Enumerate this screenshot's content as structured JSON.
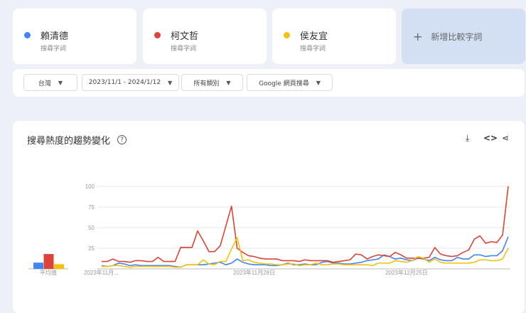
{
  "terms": [
    {
      "name": "賴清德",
      "sub": "搜尋字詞",
      "color": "#4285f4"
    },
    {
      "name": "柯文哲",
      "sub": "搜尋字詞",
      "color": "#db4437"
    },
    {
      "name": "侯友宜",
      "sub": "搜尋字詞",
      "color": "#f4c20d"
    }
  ],
  "add_term": {
    "label": "新增比較字詞",
    "icon": "plus-icon"
  },
  "filters": {
    "region": "台灣",
    "date_range": "2023/11/1 - 2024/1/12",
    "category": "所有類別",
    "search_type": "Google 網頁搜尋"
  },
  "chart_section": {
    "title": "搜尋熱度的趨勢變化",
    "help": "?",
    "icons": [
      "download-icon",
      "embed-icon",
      "share-icon"
    ]
  },
  "chart_data": {
    "type": "line",
    "title": "搜尋熱度的趨勢變化",
    "ylim": [
      0,
      100
    ],
    "yticks": [
      "100",
      "75",
      "50",
      "25"
    ],
    "xtick_labels": [
      "2023年11月...",
      "2023年11月28日",
      "2023年12月25日"
    ],
    "x_start": "2023-11-01",
    "x_end": "2024-01-12",
    "average_label": "平均值",
    "averages": [
      8,
      19,
      6
    ],
    "series": [
      {
        "name": "賴清德",
        "color": "#4285f4",
        "values": [
          4,
          3,
          4,
          7,
          6,
          4,
          5,
          4,
          4,
          4,
          4,
          4,
          4,
          3,
          2,
          5,
          5,
          5,
          5,
          6,
          7,
          8,
          5,
          7,
          12,
          8,
          6,
          5,
          5,
          5,
          4,
          4,
          5,
          7,
          5,
          5,
          6,
          5,
          5,
          8,
          9,
          7,
          7,
          6,
          6,
          7,
          8,
          10,
          11,
          12,
          17,
          15,
          12,
          13,
          11,
          10,
          13,
          12,
          10,
          14,
          11,
          10,
          10,
          14,
          12,
          12,
          17,
          17,
          15,
          16,
          16,
          22,
          39
        ]
      },
      {
        "name": "柯文哲",
        "color": "#db4437",
        "values": [
          9,
          9,
          12,
          9,
          9,
          8,
          10,
          10,
          9,
          9,
          14,
          9,
          9,
          9,
          26,
          26,
          26,
          46,
          34,
          21,
          21,
          28,
          52,
          76,
          25,
          20,
          16,
          15,
          13,
          12,
          12,
          12,
          10,
          10,
          10,
          9,
          11,
          10,
          10,
          10,
          10,
          8,
          9,
          10,
          11,
          18,
          17,
          12,
          15,
          17,
          16,
          15,
          20,
          17,
          13,
          13,
          13,
          13,
          14,
          26,
          18,
          16,
          15,
          16,
          20,
          23,
          36,
          40,
          31,
          33,
          32,
          41,
          100
        ]
      },
      {
        "name": "侯友宜",
        "color": "#f4c20d",
        "values": [
          3,
          3,
          4,
          4,
          3,
          2,
          3,
          3,
          3,
          3,
          3,
          3,
          3,
          2,
          2,
          5,
          5,
          5,
          11,
          6,
          5,
          9,
          9,
          24,
          38,
          10,
          11,
          8,
          7,
          6,
          6,
          5,
          5,
          6,
          6,
          4,
          5,
          5,
          7,
          5,
          5,
          6,
          6,
          5,
          5,
          5,
          5,
          5,
          4,
          7,
          7,
          7,
          10,
          9,
          8,
          10,
          15,
          13,
          8,
          12,
          8,
          7,
          7,
          7,
          7,
          7,
          8,
          11,
          11,
          10,
          10,
          12,
          25
        ]
      }
    ]
  }
}
